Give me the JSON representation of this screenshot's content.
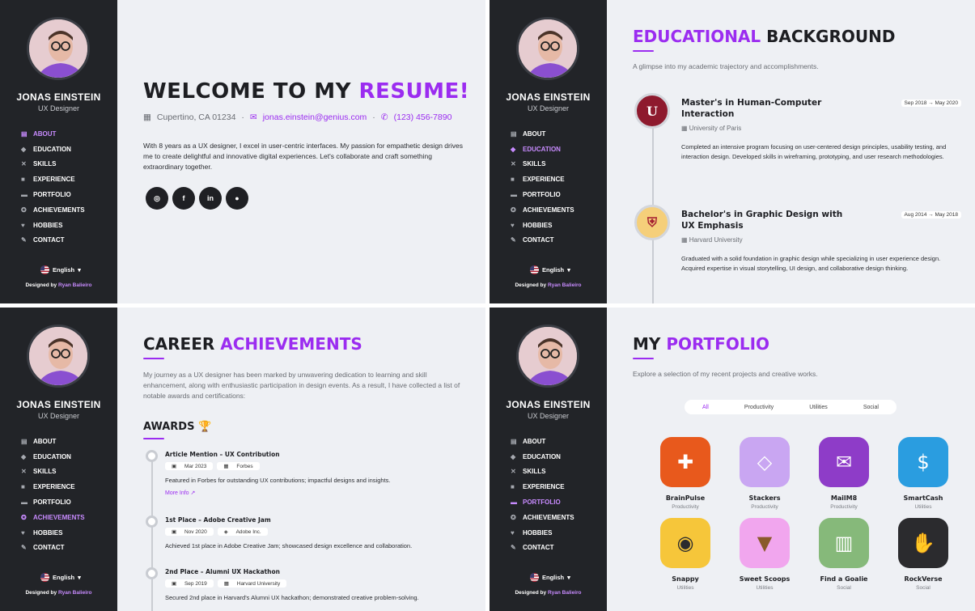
{
  "profile": {
    "name": "JONAS EINSTEIN",
    "role": "UX Designer",
    "language": "English",
    "credit_prefix": "Designed by",
    "credit_name": "Ryan Balieiro"
  },
  "nav": {
    "items": [
      "ABOUT",
      "EDUCATION",
      "SKILLS",
      "EXPERIENCE",
      "PORTFOLIO",
      "ACHIEVEMENTS",
      "HOBBIES",
      "CONTACT"
    ],
    "icons": [
      "id-card-icon",
      "graduation-cap-icon",
      "tools-icon",
      "briefcase-icon",
      "folder-icon",
      "award-icon",
      "heart-icon",
      "edit-icon"
    ]
  },
  "about": {
    "title_a": "WELCOME TO MY",
    "title_b": "RESUME!",
    "location": "Cupertino, CA 01234",
    "email": "jonas.einstein@genius.com",
    "phone": "(123) 456-7890",
    "bio": "With 8 years as a UX designer, I excel in user-centric interfaces. My passion for empathetic design drives me to create delightful and innovative digital experiences. Let's collaborate and craft something extraordinary together.",
    "socials": [
      "instagram-icon",
      "facebook-icon",
      "linkedin-icon",
      "github-icon"
    ]
  },
  "education": {
    "title_a": "EDUCATIONAL",
    "title_b": "BACKGROUND",
    "subtitle": "A glimpse into my academic trajectory and accomplishments.",
    "entries": [
      {
        "degree": "Master's in Human-Computer Interaction",
        "school": "University of Paris",
        "date": "Sep 2018 → May 2020",
        "desc": "Completed an intensive program focusing on user-centered design principles, usability testing, and interaction design. Developed skills in wireframing, prototyping, and user research methodologies."
      },
      {
        "degree": "Bachelor's in Graphic Design with UX Emphasis",
        "school": "Harvard University",
        "date": "Aug 2014 → May 2018",
        "desc": "Graduated with a solid foundation in graphic design while specializing in user experience design. Acquired expertise in visual storytelling, UI design, and collaborative design thinking."
      }
    ]
  },
  "achievements": {
    "title_a": "CAREER",
    "title_b": "ACHIEVEMENTS",
    "intro": "My journey as a UX designer has been marked by unwavering dedication to learning and skill enhancement, along with enthusiastic participation in design events. As a result, I have collected a list of notable awards and certifications:",
    "awards_title": "AWARDS",
    "items": [
      {
        "title": "Article Mention – UX Contribution",
        "date": "Mar 2023",
        "org": "Forbes",
        "desc": "Featured in Forbes for outstanding UX contributions; impactful designs and insights.",
        "more": "More Info"
      },
      {
        "title": "1st Place – Adobe Creative Jam",
        "date": "Nov 2020",
        "org": "Adobe Inc.",
        "desc": "Achieved 1st place in Adobe Creative Jam; showcased design excellence and collaboration."
      },
      {
        "title": "2nd Place – Alumni UX Hackathon",
        "date": "Sep 2019",
        "org": "Harvard University",
        "desc": "Secured 2nd place in Harvard's Alumni UX hackathon; demonstrated creative problem-solving."
      }
    ]
  },
  "portfolio": {
    "title_a": "MY",
    "title_b": "PORTFOLIO",
    "subtitle": "Explore a selection of my recent projects and creative works.",
    "filters": [
      "All",
      "Productivity",
      "Utilities",
      "Social"
    ],
    "apps": [
      {
        "name": "BrainPulse",
        "cat": "Productivity",
        "icon": "puzzle-icon",
        "color": "#e8591c"
      },
      {
        "name": "Stackers",
        "cat": "Productivity",
        "icon": "layers-icon",
        "color": "#c9a6f2"
      },
      {
        "name": "MailM8",
        "cat": "Productivity",
        "icon": "envelope-icon",
        "color": "#8e3cc8"
      },
      {
        "name": "SmartCash",
        "cat": "Utilities",
        "icon": "money-icon",
        "color": "#2a9de0"
      },
      {
        "name": "Snappy",
        "cat": "Utilities",
        "icon": "camera-icon",
        "color": "#f6c63a"
      },
      {
        "name": "Sweet Scoops",
        "cat": "Utilities",
        "icon": "ice-cream-icon",
        "color": "#f1a6ee"
      },
      {
        "name": "Find a Goalie",
        "cat": "Social",
        "icon": "goal-icon",
        "color": "#86b97a"
      },
      {
        "name": "RockVerse",
        "cat": "Social",
        "icon": "rock-hand-icon",
        "color": "#2b2b2e"
      }
    ]
  },
  "colors": {
    "accent": "#9b2cf0",
    "sidebar": "#222428",
    "background": "#eef0f4"
  }
}
